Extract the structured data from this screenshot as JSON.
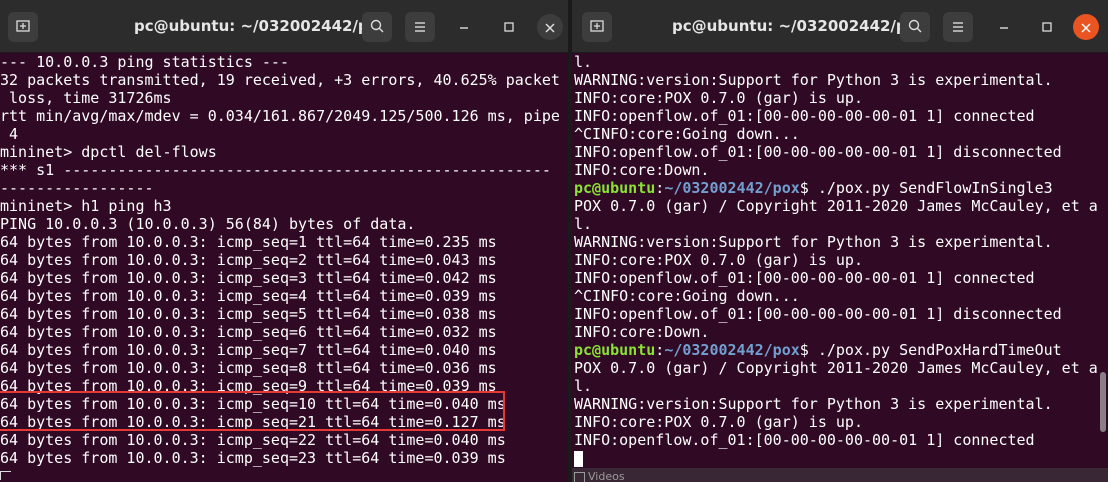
{
  "left_terminal": {
    "title": "pc@ubuntu: ~/032002442/pox",
    "lines": [
      "--- 10.0.0.3 ping statistics ---",
      "32 packets transmitted, 19 received, +3 errors, 40.625% packet",
      " loss, time 31726ms",
      "rtt min/avg/max/mdev = 0.034/161.867/2049.125/500.126 ms, pipe",
      " 4",
      "mininet> dpctl del-flows",
      "*** s1 ------------------------------------------------------",
      "-----------------",
      "mininet> h1 ping h3",
      "PING 10.0.0.3 (10.0.0.3) 56(84) bytes of data.",
      "64 bytes from 10.0.0.3: icmp_seq=1 ttl=64 time=0.235 ms",
      "64 bytes from 10.0.0.3: icmp_seq=2 ttl=64 time=0.043 ms",
      "64 bytes from 10.0.0.3: icmp_seq=3 ttl=64 time=0.042 ms",
      "64 bytes from 10.0.0.3: icmp_seq=4 ttl=64 time=0.039 ms",
      "64 bytes from 10.0.0.3: icmp_seq=5 ttl=64 time=0.038 ms",
      "64 bytes from 10.0.0.3: icmp_seq=6 ttl=64 time=0.032 ms",
      "64 bytes from 10.0.0.3: icmp_seq=7 ttl=64 time=0.040 ms",
      "64 bytes from 10.0.0.3: icmp_seq=8 ttl=64 time=0.036 ms",
      "64 bytes from 10.0.0.3: icmp_seq=9 ttl=64 time=0.039 ms",
      "64 bytes from 10.0.0.3: icmp_seq=10 ttl=64 time=0.040 ms",
      "64 bytes from 10.0.0.3: icmp_seq=21 ttl=64 time=0.127 ms",
      "64 bytes from 10.0.0.3: icmp_seq=22 ttl=64 time=0.040 ms",
      "64 bytes from 10.0.0.3: icmp_seq=23 ttl=64 time=0.039 ms"
    ]
  },
  "right_terminal": {
    "title": "pc@ubuntu: ~/032002442/pox",
    "prompt_user": "pc@ubuntu",
    "prompt_colon": ":",
    "prompt_path": "~/032002442/pox",
    "lines": [
      "l.",
      "WARNING:version:Support for Python 3 is experimental.",
      "INFO:core:POX 0.7.0 (gar) is up.",
      "INFO:openflow.of_01:[00-00-00-00-00-01 1] connected",
      "^CINFO:core:Going down...",
      "INFO:openflow.of_01:[00-00-00-00-00-01 1] disconnected",
      "INFO:core:Down.",
      "$ ./pox.py SendFlowInSingle3",
      "POX 0.7.0 (gar) / Copyright 2011-2020 James McCauley, et a",
      "l.",
      "WARNING:version:Support for Python 3 is experimental.",
      "INFO:core:POX 0.7.0 (gar) is up.",
      "INFO:openflow.of_01:[00-00-00-00-00-01 1] connected",
      "^CINFO:core:Going down...",
      "INFO:openflow.of_01:[00-00-00-00-00-01 1] disconnected",
      "INFO:core:Down.",
      "$ ./pox.py SendPoxHardTimeOut",
      "POX 0.7.0 (gar) / Copyright 2011-2020 James McCauley, et a",
      "l.",
      "WARNING:version:Support for Python 3 is experimental.",
      "INFO:core:POX 0.7.0 (gar) is up.",
      "INFO:openflow.of_01:[00-00-00-00-00-01 1] connected"
    ]
  },
  "taskbar": {
    "videos_label": "Videos"
  },
  "colors": {
    "terminal_bg": "#300a24",
    "prompt_user": "#8ae234",
    "prompt_path": "#729fcf",
    "highlight": "#e53935",
    "close_active": "#e95420"
  },
  "icons": [
    "new-tab-icon",
    "search-icon",
    "hamburger-menu-icon",
    "minimize-icon",
    "maximize-icon",
    "close-icon"
  ]
}
